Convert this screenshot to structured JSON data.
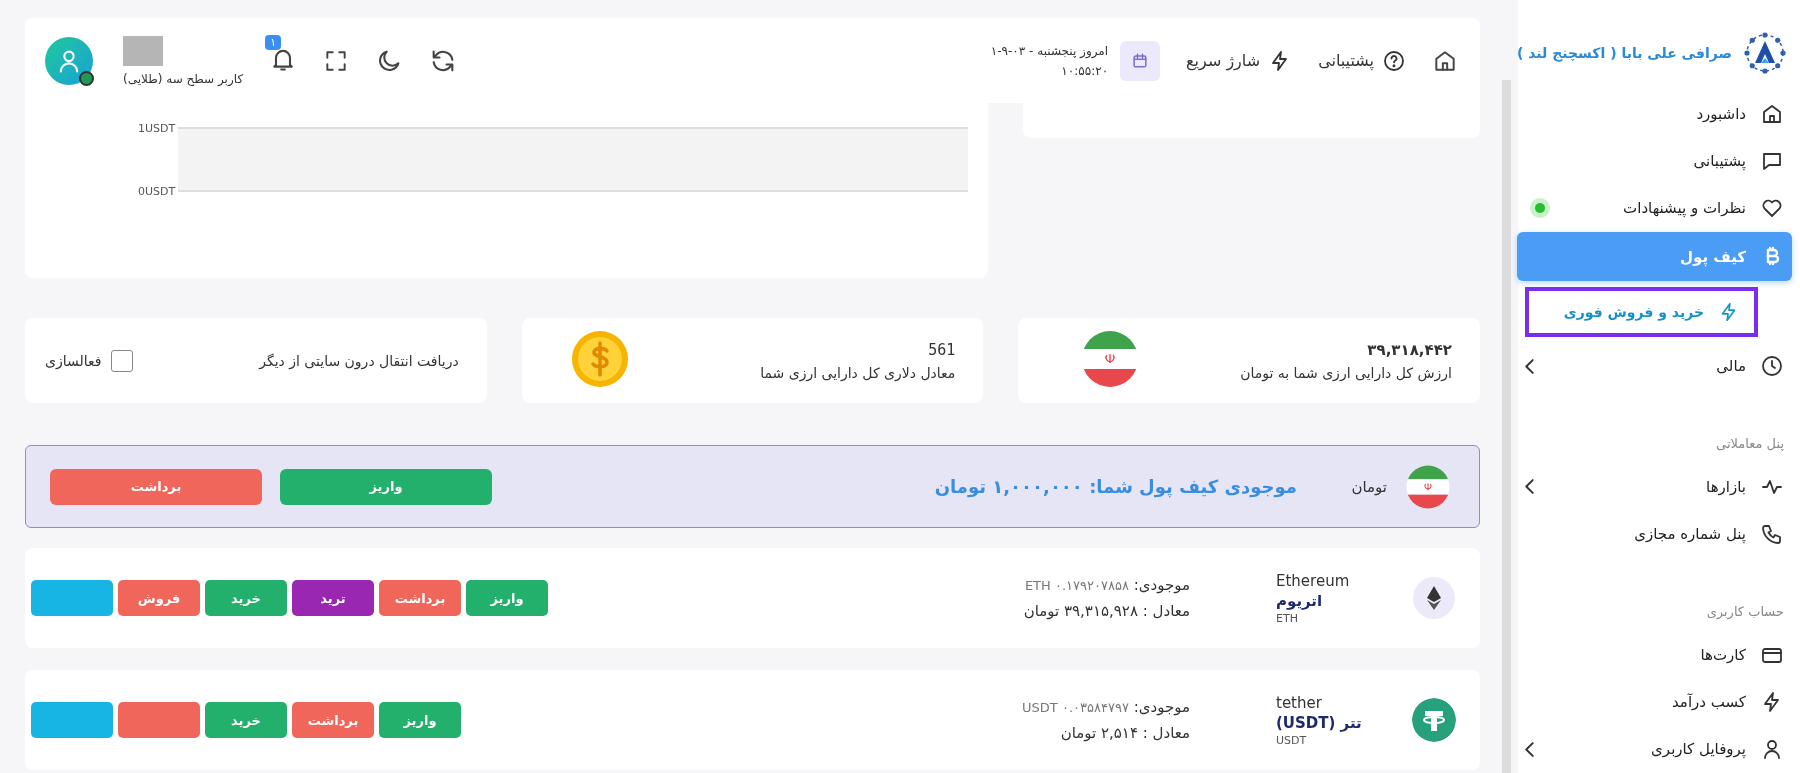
{
  "header": {
    "links": [
      {
        "label": "پشتیبانی"
      },
      {
        "label": "شارژ سریع"
      }
    ],
    "date": "امروز پنجشنبه - ۰۳-۹-۱",
    "time": "۱۰:۵۵:۲۰",
    "notifications": "۱",
    "user_level": "کاربر سطح سه (طلایی)",
    "online": true
  },
  "chart": {
    "axis_labels": [
      "1USDT",
      "0USDT"
    ]
  },
  "summary": [
    {
      "kind": "flag",
      "value": "۳۹,۳۱۸,۴۴۲",
      "label": "ارزش کل دارایی ارزی شما به تومان"
    },
    {
      "kind": "coin",
      "value": "561",
      "label": "معادل دلاری کل دارایی ارزی شما"
    }
  ],
  "transfer": {
    "label": "دریافت انتقال درون سایتی از دیگر",
    "checkbox_label": "فعالسازی",
    "checked": false
  },
  "wallet": {
    "currency": "تومان",
    "balance": "موجودی کیف پول شما: ۱,۰۰۰,۰۰۰ تومان",
    "actions": [
      {
        "kind": "deposit",
        "label": "واریز"
      },
      {
        "kind": "withdraw",
        "label": "برداشت"
      }
    ]
  },
  "assets": [
    {
      "kind": "eth",
      "name": "Ethereum",
      "local_name": "اتریوم",
      "symbol": "ETH",
      "balance_label": "موجودی:",
      "balance": "۰.۱۷۹۲۰۷۸۵۸ ETH",
      "equivalent": "معادل : ۳۹,۳۱۵,۹۲۸ تومان",
      "actions": [
        {
          "kind": "deposit",
          "label": "واریز"
        },
        {
          "kind": "withdraw",
          "label": "برداشت"
        },
        {
          "kind": "trade",
          "label": "ترید"
        },
        {
          "kind": "buy",
          "label": "خرید"
        },
        {
          "kind": "sell",
          "label": "فروش"
        },
        {
          "kind": "info"
        }
      ]
    },
    {
      "kind": "usdt",
      "name": "tether",
      "local_name": "تتر (USDT)",
      "symbol": "USDT",
      "balance_label": "موجودی:",
      "balance": "۰.۰۳۵۸۴۷۹۷ USDT",
      "equivalent": "معادل : ۲,۵۱۴ تومان",
      "actions": [
        {
          "kind": "deposit",
          "label": "واریز"
        },
        {
          "kind": "withdraw",
          "label": "برداشت"
        },
        {
          "kind": "buy",
          "label": "خرید"
        },
        {
          "kind": "sell"
        },
        {
          "kind": "info"
        }
      ]
    }
  ],
  "sidebar": {
    "brand": "صرافی علی بابا ( اکسچنج لند )",
    "items": [
      {
        "kind": "item",
        "label": "داشبورد",
        "selected": false,
        "expandable": false,
        "dot": false
      },
      {
        "kind": "item",
        "label": "پشتیبانی",
        "selected": false,
        "expandable": false,
        "dot": false
      },
      {
        "kind": "item",
        "label": "نظرات و پیشنهادات",
        "selected": false,
        "expandable": false,
        "dot": true
      },
      {
        "kind": "item",
        "label": "کیف پول",
        "selected": true,
        "expandable": false,
        "dot": false
      },
      {
        "kind": "subitem",
        "label": "خرید و فروش فوری",
        "selected": false,
        "highlighted": true
      },
      {
        "kind": "item",
        "label": "مالی",
        "selected": false,
        "expandable": true,
        "dot": false
      },
      {
        "kind": "heading",
        "label": "پنل معاملاتی"
      },
      {
        "kind": "item",
        "label": "بازارها",
        "selected": false,
        "expandable": true,
        "dot": false
      },
      {
        "kind": "item",
        "label": "پنل شماره مجازی",
        "selected": false,
        "expandable": false,
        "dot": false
      },
      {
        "kind": "heading",
        "label": "حساب کاربری"
      },
      {
        "kind": "item",
        "label": "کارت‌ها",
        "selected": false,
        "expandable": false,
        "dot": false
      },
      {
        "kind": "item",
        "label": "کسب درآمد",
        "selected": false,
        "expandable": false,
        "dot": false
      },
      {
        "kind": "item",
        "label": "پروفایل کاربری",
        "selected": false,
        "expandable": true,
        "dot": false
      }
    ]
  }
}
